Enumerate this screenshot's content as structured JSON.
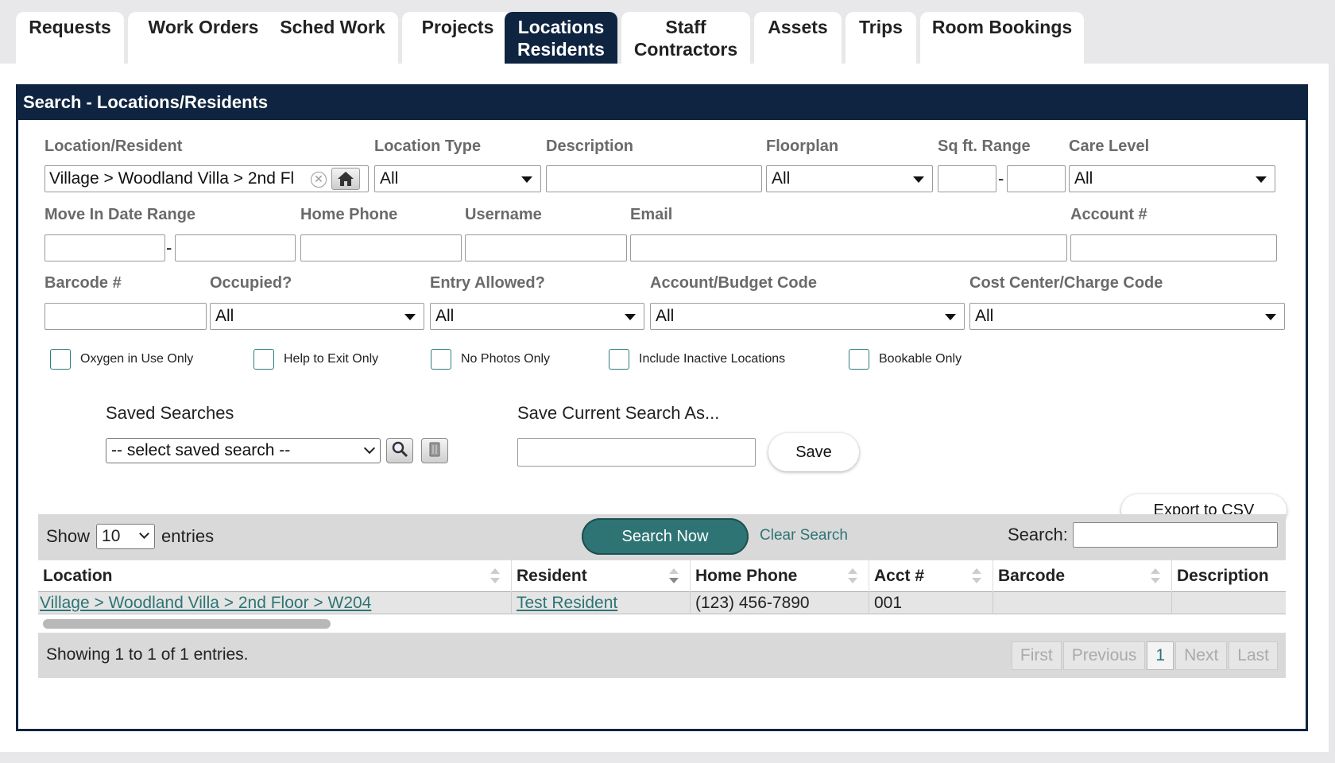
{
  "tabs": [
    {
      "label": "Requests",
      "active": false
    },
    {
      "label": "Work Orders",
      "active": false
    },
    {
      "label": "Sched Work",
      "active": false
    },
    {
      "label": "Projects",
      "active": false
    },
    {
      "label": "Locations\nResidents",
      "active": true
    },
    {
      "label": "Staff\nContractors",
      "active": false
    },
    {
      "label": "Assets",
      "active": false
    },
    {
      "label": "Trips",
      "active": false
    },
    {
      "label": "Room Bookings",
      "active": false
    }
  ],
  "search": {
    "title": "Search - Locations/Residents",
    "labels": {
      "location_resident": "Location/Resident",
      "location_type": "Location Type",
      "description": "Description",
      "floorplan": "Floorplan",
      "sqft_range": "Sq ft. Range",
      "care_level": "Care Level",
      "move_in_range": "Move In Date Range",
      "home_phone": "Home Phone",
      "username": "Username",
      "email": "Email",
      "account_no": "Account #",
      "barcode": "Barcode #",
      "occupied": "Occupied?",
      "entry_allowed": "Entry Allowed?",
      "account_budget": "Account/Budget Code",
      "cost_center": "Cost Center/Charge Code"
    },
    "values": {
      "location_resident": "Village > Woodland Villa > 2nd Fl",
      "location_type": "All",
      "floorplan": "All",
      "care_level": "All",
      "occupied": "All",
      "entry_allowed": "All",
      "account_budget": "All",
      "cost_center": "All"
    },
    "checkboxes": [
      {
        "label": "Oxygen in Use Only",
        "checked": false
      },
      {
        "label": "Help to Exit Only",
        "checked": false
      },
      {
        "label": "No Photos Only",
        "checked": false
      },
      {
        "label": "Include Inactive Locations",
        "checked": false
      },
      {
        "label": "Bookable Only",
        "checked": false
      }
    ],
    "saved_searches_label": "Saved Searches",
    "saved_searches_value": "-- select saved search --",
    "save_as_label": "Save Current Search As...",
    "save_button": "Save",
    "export_button": "Export to CSV"
  },
  "table": {
    "show_label": "Show",
    "show_value": "10",
    "entries_label": "entries",
    "search_now": "Search Now",
    "clear_search": "Clear Search",
    "search_label": "Search:",
    "columns": [
      "Location",
      "Resident",
      "Home Phone",
      "Acct #",
      "Barcode",
      "Description"
    ],
    "rows": [
      {
        "location": "Village > Woodland Villa > 2nd Floor > W204",
        "resident": "Test Resident",
        "home_phone": "(123) 456-7890",
        "acct": "001",
        "barcode": "",
        "description": ""
      }
    ],
    "showing": "Showing 1 to 1 of 1 entries.",
    "pager": [
      "First",
      "Previous",
      "1",
      "Next",
      "Last"
    ]
  }
}
